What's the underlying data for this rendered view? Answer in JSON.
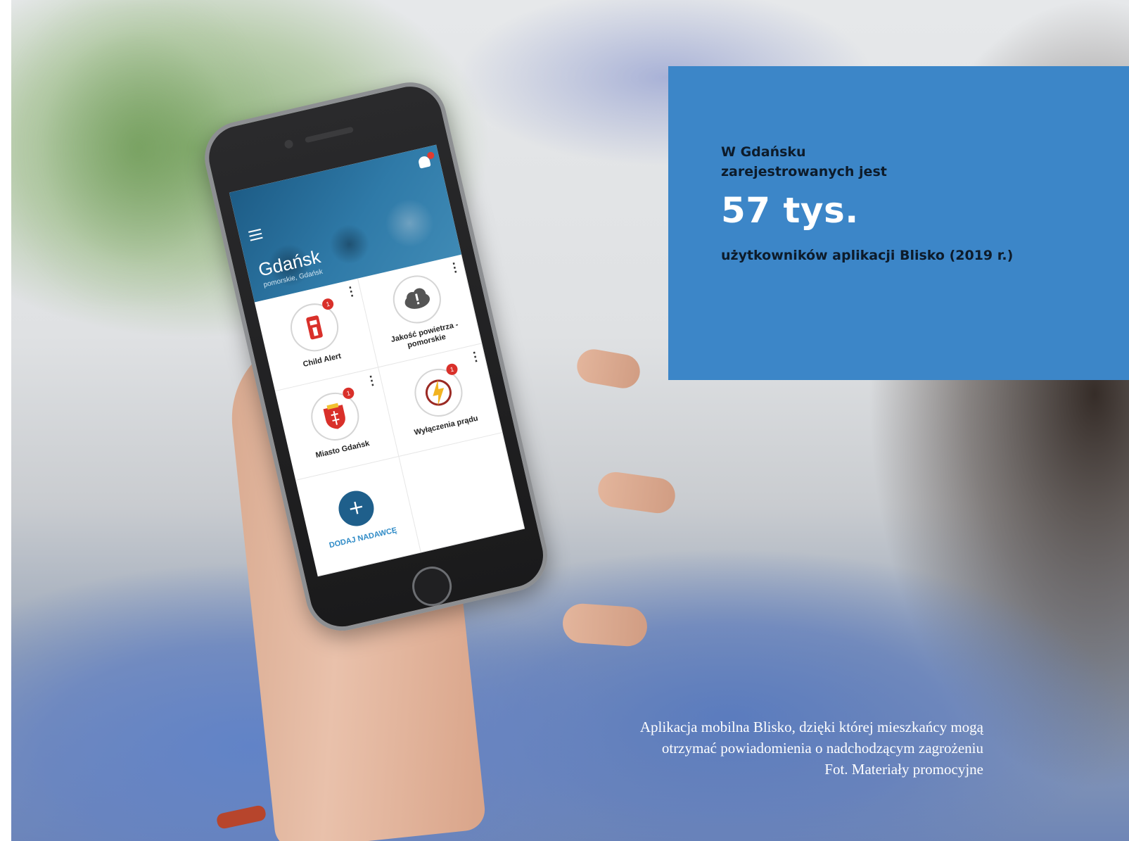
{
  "info_box": {
    "pre_text_line1": "W Gdańsku",
    "pre_text_line2": "zarejestrowanych jest",
    "big_number": "57 tys.",
    "post_text": "użytkowników aplikacji Blisko (2019 r.)",
    "background_color": "#3c86c8"
  },
  "phone_app": {
    "city": "Gdańsk",
    "city_subtitle": "pomorskie, Gdańsk",
    "header_color": "#1d5c86",
    "tiles": [
      {
        "label": "Child Alert",
        "badge": "1",
        "icon": "child-alert-icon"
      },
      {
        "label": "Jakość powietrza - pomorskie",
        "badge": "",
        "icon": "cloud-alert-icon"
      },
      {
        "label": "Miasto Gdańsk",
        "badge": "1",
        "icon": "gdansk-coat-of-arms-icon"
      },
      {
        "label": "Wyłączenia prądu",
        "badge": "1",
        "icon": "lightning-icon"
      }
    ],
    "add_button": {
      "symbol": "+",
      "label": "DODAJ NADAWCĘ"
    }
  },
  "caption": {
    "line1": "Aplikacja mobilna Blisko, dzięki której mieszkańcy mogą",
    "line2": "otrzymać powiadomienia o nadchodzącym zagrożeniu",
    "line3": "Fot. Materiały promocyjne"
  }
}
